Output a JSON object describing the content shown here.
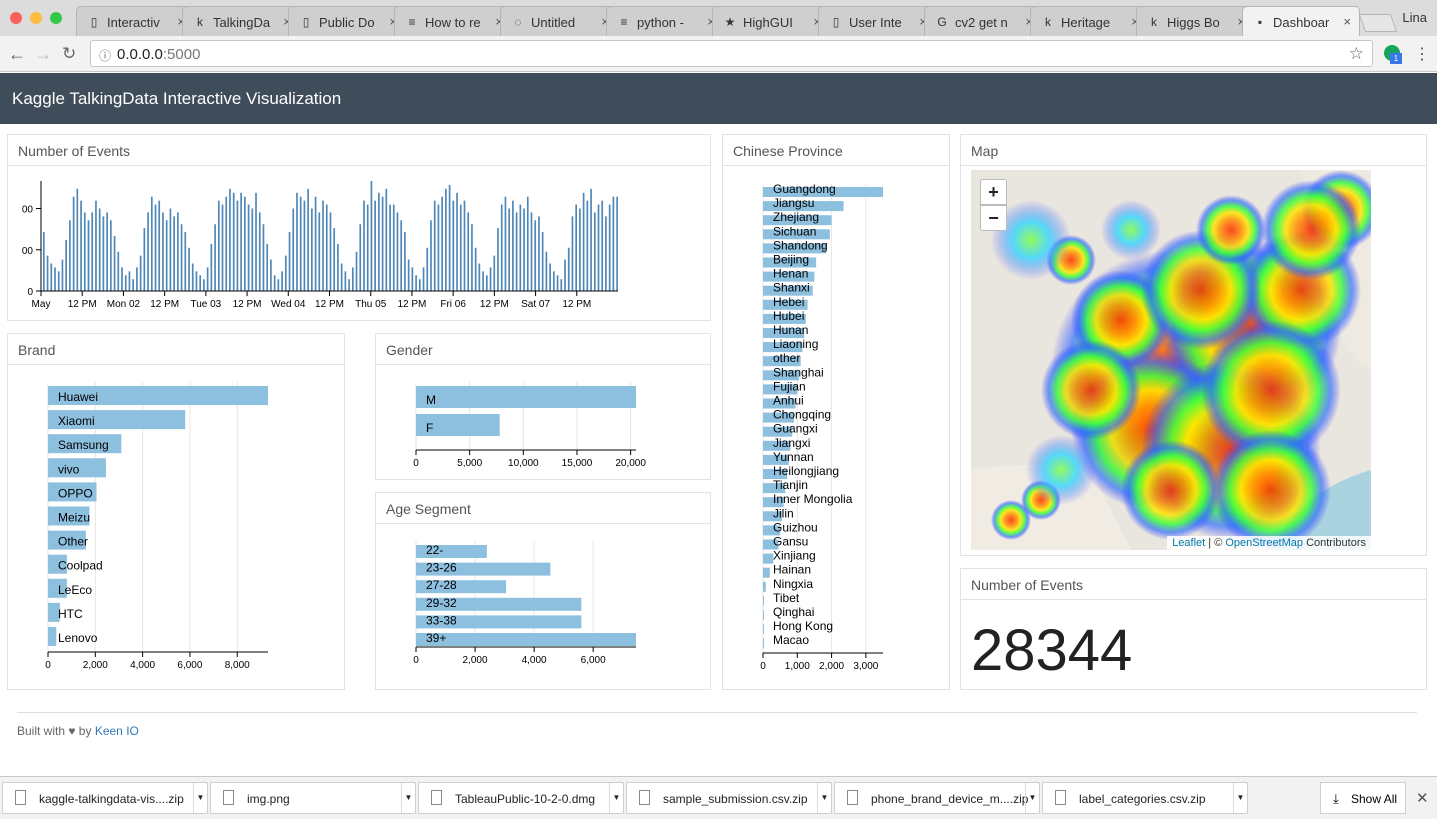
{
  "browser": {
    "tabs": [
      {
        "label": "Interactiv",
        "icon": "doc-icon",
        "icon_glyph": "▯"
      },
      {
        "label": "TalkingDa",
        "icon": "kaggle-icon",
        "icon_glyph": "k"
      },
      {
        "label": "Public Do",
        "icon": "doc-icon",
        "icon_glyph": "▯"
      },
      {
        "label": "How to re",
        "icon": "stackoverflow-icon",
        "icon_glyph": "≡"
      },
      {
        "label": "Untitled",
        "icon": "jupyter-icon",
        "icon_glyph": "◌"
      },
      {
        "label": "python -",
        "icon": "stackoverflow-icon",
        "icon_glyph": "≡"
      },
      {
        "label": "HighGUI",
        "icon": "star-icon",
        "icon_glyph": "★"
      },
      {
        "label": "User Inte",
        "icon": "doc-icon",
        "icon_glyph": "▯"
      },
      {
        "label": "cv2 get n",
        "icon": "google-icon",
        "icon_glyph": "G"
      },
      {
        "label": "Heritage",
        "icon": "kaggle-icon",
        "icon_glyph": "k"
      },
      {
        "label": "Higgs Bo",
        "icon": "kaggle-icon",
        "icon_glyph": "k"
      },
      {
        "label": "Dashboar",
        "icon": "terminal-icon",
        "icon_glyph": "▪"
      }
    ],
    "profile": "Lina",
    "url_host": "0.0.0.0",
    "url_port": ":5000"
  },
  "app": {
    "title": "Kaggle TalkingData Interactive Visualization"
  },
  "panels": {
    "events_chart": "Number of Events",
    "brand": "Brand",
    "gender": "Gender",
    "age": "Age Segment",
    "province": "Chinese Province",
    "map": "Map",
    "events_count": "Number of Events"
  },
  "events_count_value": "28344",
  "map": {
    "zoom_in": "+",
    "zoom_out": "−",
    "attribution_leaflet": "Leaflet",
    "attribution_sep": " | © ",
    "attribution_osm": "OpenStreetMap",
    "attribution_tail": " Contributors"
  },
  "footer": {
    "prefix": "Built with ♥ by ",
    "link": "Keen IO"
  },
  "downloads": {
    "items": [
      "kaggle-talkingdata-vis....zip",
      "img.png",
      "TableauPublic-10-2-0.dmg",
      "sample_submission.csv.zip",
      "phone_brand_device_m....zip",
      "label_categories.csv.zip"
    ],
    "show_all": "Show All"
  },
  "chart_data": [
    {
      "type": "bar",
      "name": "events_timeline",
      "x_ticks": [
        "May",
        "12 PM",
        "Mon 02",
        "12 PM",
        "Tue 03",
        "12 PM",
        "Wed 04",
        "12 PM",
        "Thu 05",
        "12 PM",
        "Fri 06",
        "12 PM",
        "Sat 07",
        "12 PM"
      ],
      "y_ticks": [
        "0",
        "00",
        "00"
      ],
      "values": [
        150,
        90,
        70,
        60,
        50,
        80,
        130,
        180,
        240,
        260,
        230,
        200,
        180,
        200,
        230,
        210,
        190,
        200,
        180,
        140,
        100,
        60,
        40,
        50,
        30,
        60,
        90,
        160,
        200,
        240,
        220,
        230,
        200,
        180,
        210,
        190,
        200,
        170,
        150,
        110,
        70,
        50,
        40,
        30,
        60,
        120,
        170,
        230,
        220,
        240,
        260,
        250,
        230,
        250,
        240,
        220,
        210,
        250,
        200,
        170,
        120,
        80,
        40,
        30,
        50,
        90,
        150,
        210,
        250,
        240,
        230,
        260,
        210,
        240,
        200,
        230,
        220,
        200,
        160,
        120,
        70,
        50,
        30,
        60,
        100,
        170,
        230,
        220,
        280,
        230,
        250,
        240,
        260,
        220,
        220,
        200,
        180,
        150,
        80,
        60,
        40,
        30,
        60,
        110,
        180,
        230,
        220,
        240,
        260,
        270,
        230,
        250,
        220,
        230,
        200,
        170,
        110,
        70,
        50,
        40,
        60,
        90,
        160,
        220,
        240,
        210,
        230,
        200,
        220,
        210,
        240,
        200,
        180,
        190,
        150,
        100,
        70,
        50,
        40,
        30,
        80,
        110,
        190,
        220,
        210,
        250,
        230,
        260,
        200,
        220,
        230,
        190,
        220,
        240,
        240
      ],
      "ylim": [
        0,
        280
      ]
    },
    {
      "type": "bar",
      "name": "brand",
      "orientation": "horizontal",
      "categories": [
        "Huawei",
        "Xiaomi",
        "Samsung",
        "vivo",
        "OPPO",
        "Meizu",
        "Other",
        "Coolpad",
        "LeEco",
        "HTC",
        "Lenovo"
      ],
      "values": [
        9300,
        5800,
        3100,
        2450,
        2050,
        1750,
        1600,
        800,
        800,
        500,
        350
      ],
      "x_ticks": [
        0,
        2000,
        4000,
        6000,
        8000
      ],
      "xlim": [
        0,
        9300
      ]
    },
    {
      "type": "bar",
      "name": "gender",
      "orientation": "horizontal",
      "categories": [
        "M",
        "F"
      ],
      "values": [
        20500,
        7800
      ],
      "x_ticks": [
        0,
        5000,
        10000,
        15000,
        20000
      ],
      "xlim": [
        0,
        20500
      ]
    },
    {
      "type": "bar",
      "name": "age_segment",
      "orientation": "horizontal",
      "categories": [
        "22-",
        "23-26",
        "27-28",
        "29-32",
        "33-38",
        "39+"
      ],
      "values": [
        2400,
        4550,
        3050,
        5600,
        5600,
        7450
      ],
      "x_ticks": [
        0,
        2000,
        4000,
        6000
      ],
      "xlim": [
        0,
        7450
      ]
    },
    {
      "type": "bar",
      "name": "province",
      "orientation": "horizontal",
      "categories": [
        "Guangdong",
        "Jiangsu",
        "Zhejiang",
        "Sichuan",
        "Shandong",
        "Beijing",
        "Henan",
        "Shanxi",
        "Hebei",
        "Hubei",
        "Hunan",
        "Liaoning",
        "other",
        "Shanghai",
        "Fujian",
        "Anhui",
        "Chongqing",
        "Guangxi",
        "Jiangxi",
        "Yunnan",
        "Heilongjiang",
        "Tianjin",
        "Inner Mongolia",
        "Jilin",
        "Guizhou",
        "Gansu",
        "Xinjiang",
        "Hainan",
        "Ningxia",
        "Tibet",
        "Qinghai",
        "Hong Kong",
        "Macao"
      ],
      "values": [
        3500,
        2350,
        2000,
        1950,
        1850,
        1550,
        1500,
        1450,
        1300,
        1250,
        1200,
        1150,
        1100,
        1050,
        1000,
        950,
        900,
        850,
        800,
        750,
        700,
        650,
        600,
        550,
        500,
        450,
        300,
        200,
        80,
        20,
        10,
        5,
        2
      ],
      "x_ticks": [
        0,
        1000,
        2000,
        3000
      ],
      "xlim": [
        0,
        3500
      ]
    }
  ]
}
